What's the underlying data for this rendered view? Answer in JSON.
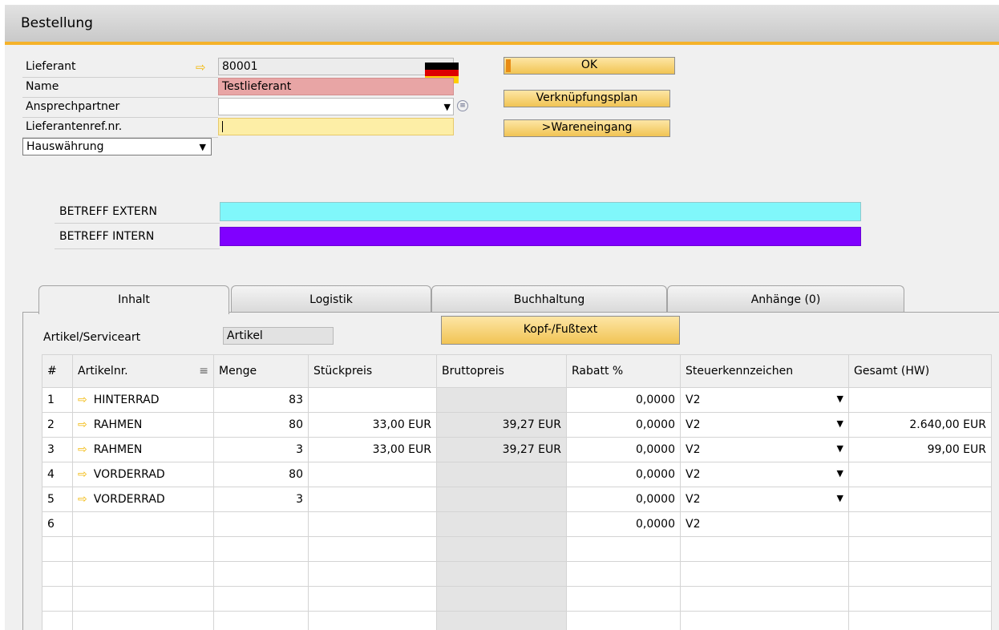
{
  "window": {
    "title": "Bestellung"
  },
  "header": {
    "supplier_label": "Lieferant",
    "supplier_value": "80001",
    "name_label": "Name",
    "name_value": "Testlieferant",
    "contact_label": "Ansprechpartner",
    "contact_value": "",
    "ref_label": "Lieferantenref.nr.",
    "ref_value": "",
    "currency_select": "Hauswährung",
    "flag_colors": [
      "#000000",
      "#dd0000",
      "#ffce00"
    ]
  },
  "buttons": {
    "ok": "OK",
    "relation_map": "Verknüpfungsplan",
    "goods_receipt": ">Wareneingang",
    "header_footer_text": "Kopf-/Fußtext"
  },
  "subjects": {
    "external_label": "BETREFF EXTERN",
    "external_color": "#80f7fb",
    "internal_label": "BETREFF INTERN",
    "internal_color": "#8000ff"
  },
  "tabs": [
    "Inhalt",
    "Logistik",
    "Buchhaltung",
    "Anhänge (0)"
  ],
  "content": {
    "item_type_label": "Artikel/Serviceart",
    "item_type_value": "Artikel"
  },
  "table": {
    "columns": [
      "#",
      "Artikelnr.",
      "Menge",
      "Stückpreis",
      "Bruttopreis",
      "Rabatt %",
      "Steuerkennzeichen",
      "Gesamt (HW)"
    ],
    "rows": [
      {
        "n": "1",
        "item": "HINTERRAD",
        "qty": "83",
        "price": "",
        "gross": "",
        "disc": "0,0000",
        "tax": "V2",
        "total": ""
      },
      {
        "n": "2",
        "item": "RAHMEN",
        "qty": "80",
        "price": "33,00 EUR",
        "gross": "39,27 EUR",
        "disc": "0,0000",
        "tax": "V2",
        "total": "2.640,00 EUR"
      },
      {
        "n": "3",
        "item": "RAHMEN",
        "qty": "3",
        "price": "33,00 EUR",
        "gross": "39,27 EUR",
        "disc": "0,0000",
        "tax": "V2",
        "total": "99,00 EUR"
      },
      {
        "n": "4",
        "item": "VORDERRAD",
        "qty": "80",
        "price": "",
        "gross": "",
        "disc": "0,0000",
        "tax": "V2",
        "total": ""
      },
      {
        "n": "5",
        "item": "VORDERRAD",
        "qty": "3",
        "price": "",
        "gross": "",
        "disc": "0,0000",
        "tax": "V2",
        "total": ""
      },
      {
        "n": "6",
        "item": "",
        "qty": "",
        "price": "",
        "gross": "",
        "disc": "0,0000",
        "tax": "V2",
        "total": ""
      }
    ]
  }
}
